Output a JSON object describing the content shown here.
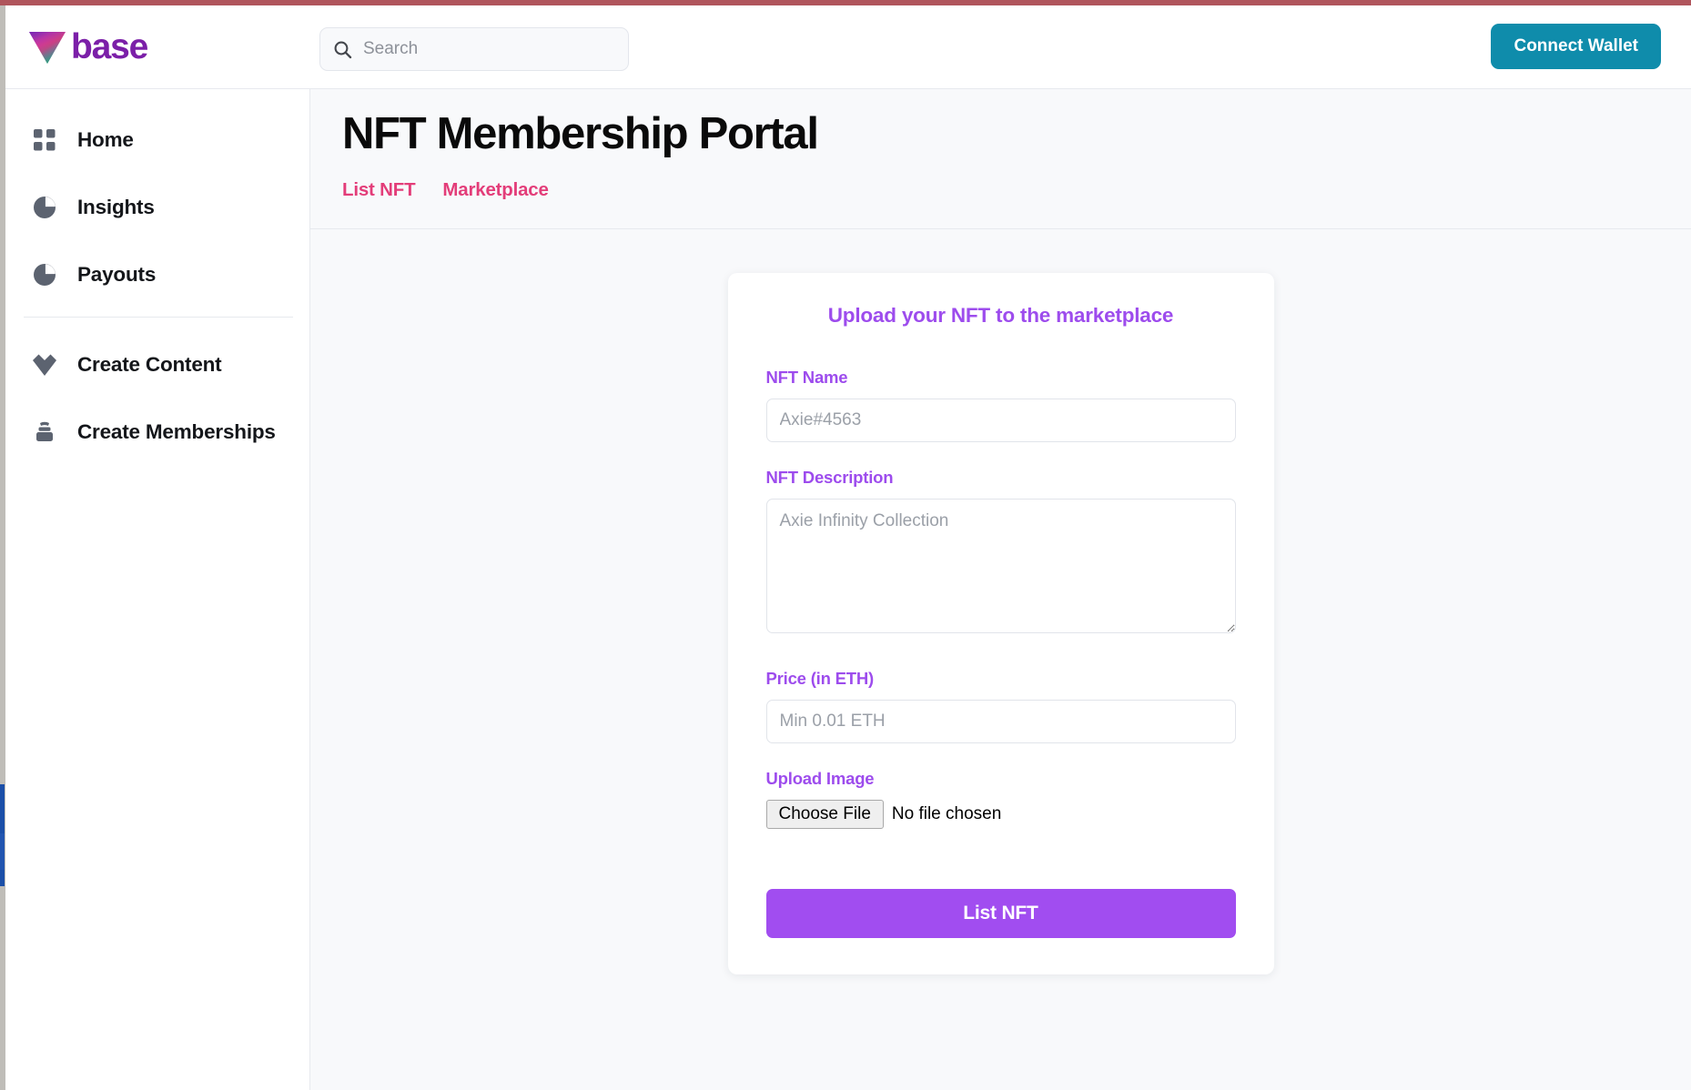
{
  "brand": {
    "name": "base",
    "logo_icon": "triangle-gradient-logo"
  },
  "header": {
    "search": {
      "icon": "search-icon",
      "placeholder": "Search",
      "value": ""
    },
    "connect_wallet_label": "Connect Wallet"
  },
  "sidebar": {
    "items": [
      {
        "label": "Home",
        "icon": "grid-icon"
      },
      {
        "label": "Insights",
        "icon": "pie-chart-icon"
      },
      {
        "label": "Payouts",
        "icon": "pie-chart-icon"
      },
      {
        "label": "Create Content",
        "icon": "diamond-icon"
      },
      {
        "label": "Create Memberships",
        "icon": "stack-icon"
      }
    ]
  },
  "main": {
    "page_title": "NFT Membership Portal",
    "tabs": [
      {
        "label": "List NFT",
        "active": true
      },
      {
        "label": "Marketplace",
        "active": false
      }
    ],
    "card": {
      "title": "Upload your NFT to the marketplace",
      "fields": {
        "nft_name": {
          "label": "NFT Name",
          "placeholder": "Axie#4563",
          "value": ""
        },
        "nft_description": {
          "label": "NFT Description",
          "placeholder": "Axie Infinity Collection",
          "value": ""
        },
        "price": {
          "label": "Price (in ETH)",
          "placeholder": "Min 0.01 ETH",
          "value": ""
        },
        "upload_image": {
          "label": "Upload Image",
          "button_label": "Choose File",
          "status_text": "No file chosen"
        }
      },
      "submit_label": "List NFT"
    }
  },
  "colors": {
    "accent_purple": "#9d4ced",
    "accent_pink": "#e33d79",
    "accent_teal": "#0f8cab",
    "brand_purple": "#7b1fa8",
    "top_strip": "#b0555c",
    "edge_marker": "#1b4fa8",
    "page_bg": "#f8f9fb"
  }
}
